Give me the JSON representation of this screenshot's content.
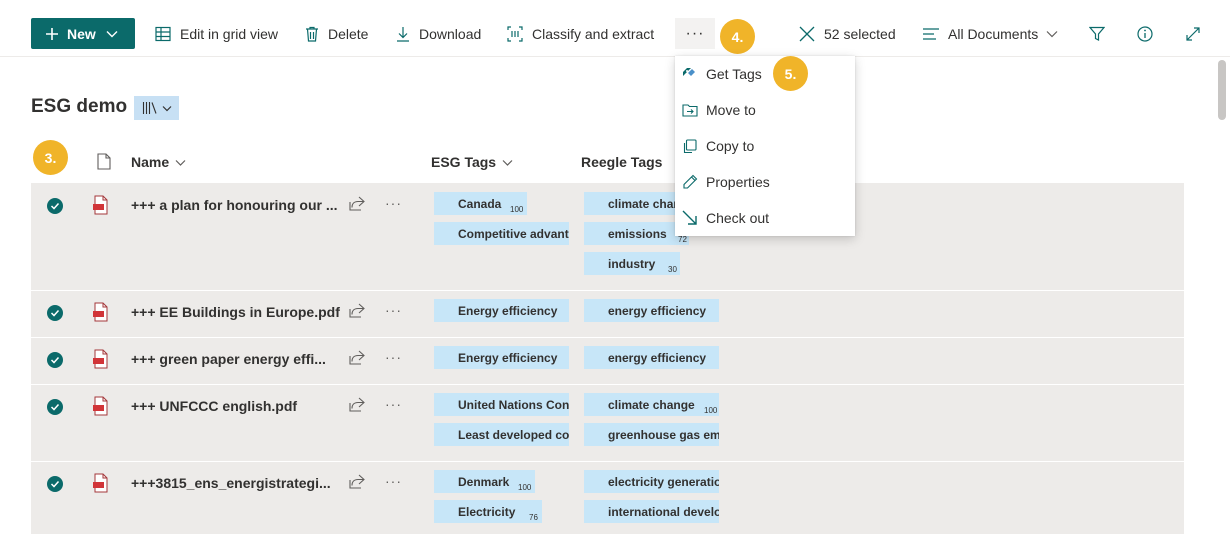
{
  "toolbar": {
    "new_label": "New",
    "edit_grid_label": "Edit in grid view",
    "delete_label": "Delete",
    "download_label": "Download",
    "classify_label": "Classify and extract",
    "more_label": "···",
    "selected_label": "52 selected",
    "view_label": "All Documents"
  },
  "badges": {
    "step3": "3.",
    "step4": "4.",
    "step5": "5."
  },
  "library": {
    "title": "ESG demo"
  },
  "columns": {
    "name": "Name",
    "esg": "ESG Tags",
    "reegle": "Reegle Tags"
  },
  "menu": {
    "items": [
      "Get Tags",
      "Move to",
      "Copy to",
      "Properties",
      "Check out"
    ]
  },
  "rows": [
    {
      "name": "+++ a plan for honouring our ...",
      "esg_tags": [
        {
          "label": "Canada",
          "score": "100"
        },
        {
          "label": "Competitive advantage",
          "score": ""
        }
      ],
      "reegle_tags": [
        {
          "label": "climate change",
          "score": ""
        },
        {
          "label": "emissions",
          "score": "72"
        },
        {
          "label": "industry",
          "score": "30"
        }
      ]
    },
    {
      "name": "+++ EE Buildings in Europe.pdf",
      "esg_tags": [
        {
          "label": "Energy efficiency",
          "score": ""
        }
      ],
      "reegle_tags": [
        {
          "label": "energy efficiency",
          "score": ""
        }
      ]
    },
    {
      "name": "+++ green paper energy effi...",
      "esg_tags": [
        {
          "label": "Energy efficiency",
          "score": ""
        }
      ],
      "reegle_tags": [
        {
          "label": "energy efficiency",
          "score": ""
        }
      ]
    },
    {
      "name": "+++ UNFCCC english.pdf",
      "esg_tags": [
        {
          "label": "United Nations Conference",
          "score": ""
        },
        {
          "label": "Least developed countries",
          "score": ""
        }
      ],
      "reegle_tags": [
        {
          "label": "climate change",
          "score": "100"
        },
        {
          "label": "greenhouse gas emissions",
          "score": ""
        }
      ]
    },
    {
      "name": "+++3815_ens_energistrategi...",
      "esg_tags": [
        {
          "label": "Denmark",
          "score": "100"
        },
        {
          "label": "Electricity",
          "score": "76"
        }
      ],
      "reegle_tags": [
        {
          "label": "electricity generation",
          "score": ""
        },
        {
          "label": "international development",
          "score": ""
        }
      ]
    }
  ],
  "colors": {
    "accent": "#0b6a6a",
    "badge": "#f0b429",
    "tag_bg": "#c7e6f8",
    "row_bg": "#edebe9"
  }
}
